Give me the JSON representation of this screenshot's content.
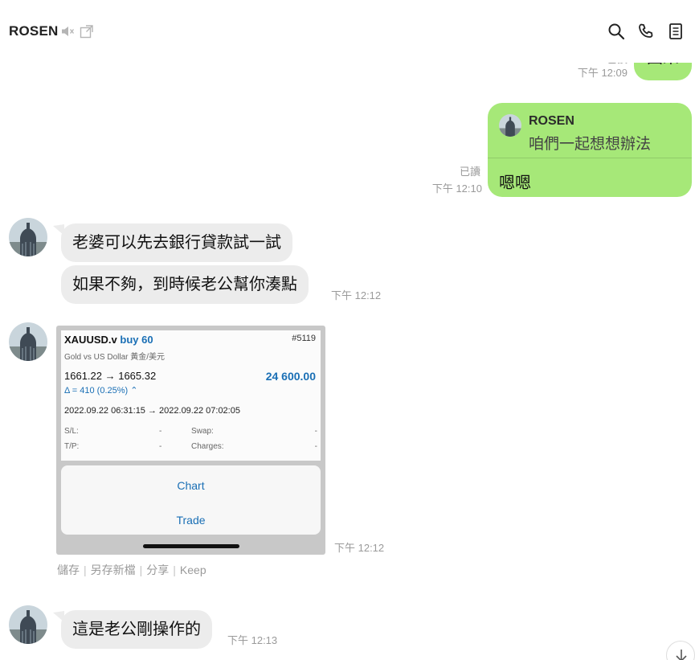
{
  "header": {
    "title": "ROSEN",
    "icons": [
      "mute-icon",
      "external-window-icon",
      "search-icon",
      "phone-icon",
      "notes-icon"
    ]
  },
  "messages": {
    "top": {
      "text": "回來",
      "read": "已讀",
      "time": "下午 12:09"
    },
    "reply": {
      "quoted_name": "ROSEN",
      "quoted_text": "咱們一起想想辦法",
      "text": "嗯嗯",
      "read": "已讀",
      "time": "下午 12:10"
    },
    "incoming1": {
      "text": "老婆可以先去銀行貸款試一試"
    },
    "incoming2": {
      "text": "如果不夠，到時候老公幫你湊點",
      "time": "下午 12:12"
    },
    "image": {
      "symbol": "XAUUSD.v",
      "side": "buy 60",
      "ticket": "#5119",
      "description": "Gold vs US Dollar 黃金/美元",
      "prices": "1661.22 → 1665.32",
      "profit": "24 600.00",
      "delta": "Δ = 410 (0.25%) ⌃",
      "dates": "2022.09.22 06:31:15 → 2022.09.22 07:02:05",
      "sl_label": "S/L:",
      "sl_value": "-",
      "swap_label": "Swap:",
      "swap_value": "-",
      "tp_label": "T/P:",
      "tp_value": "-",
      "charges_label": "Charges:",
      "charges_value": "-",
      "chart_button": "Chart",
      "trade_button": "Trade",
      "time": "下午 12:12",
      "actions": [
        "儲存",
        "另存新檔",
        "分享",
        "Keep"
      ]
    },
    "incoming3": {
      "text": "這是老公剛操作的",
      "time": "下午 12:13"
    }
  },
  "colors": {
    "outgoing_bubble": "#a6e878",
    "incoming_bubble": "#ececec",
    "meta_text": "#9a9a9a",
    "trade_blue": "#1a6fb5"
  }
}
